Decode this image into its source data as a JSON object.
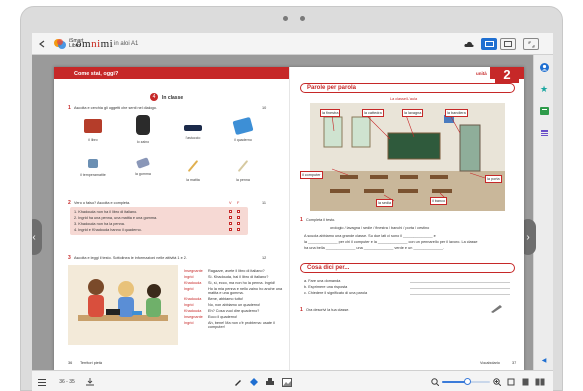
{
  "app": {
    "logo_text": "iSmart Libro",
    "brand": {
      "prefix": "om",
      "highlight": "ni",
      "suffix": "mi"
    },
    "breadcrumb": "in aloi A1"
  },
  "colors": {
    "accent": "#c62828",
    "toolbar_active": "#1f6fd1",
    "sidebar_icons": [
      "#1f6fd1",
      "#1aa6a0",
      "#2e9b4a",
      "#6a4fc9"
    ]
  },
  "left_page": {
    "tag": "Come stai, oggi?",
    "badge": "4",
    "section_title": "In classe",
    "ex1": {
      "num": "1",
      "instruction": "Ascolta e cerchia gli oggetti che senti nel dialogo.",
      "track": "10"
    },
    "items_row1": [
      "il libro",
      "lo zaino",
      "l'astuccio",
      "il quaderno"
    ],
    "items_row2": [
      "il temperamatite",
      "la gomma",
      "la matita",
      "la penna"
    ],
    "ex2": {
      "num": "2",
      "instruction": "Vero o falso? Ascolta e completa.",
      "cols": [
        "V",
        "F"
      ],
      "track": "11",
      "lines": [
        "1. Khadouda non ha il libro di italiano.",
        "2. Ingrid ha una penna, una matita e una gomma.",
        "3. Khadouda non ha la penna.",
        "4. Ingrid e Khadouda hanno il quaderno."
      ]
    },
    "ex3": {
      "num": "3",
      "instruction": "Ascolta e leggi il testo. Sottolinea le informazioni nelle attività 1 e 2.",
      "track": "12",
      "dialogue": [
        {
          "speaker": "Insegnante",
          "text": "Ragazze, avete il libro di italiano?"
        },
        {
          "speaker": "Ingrid",
          "text": "Sì. Khadouda, hai il libro di italiano?"
        },
        {
          "speaker": "Khadouda",
          "text": "Sì, sì, ecco, ma non ho la penna. Ingrid!"
        },
        {
          "speaker": "Ingrid",
          "text": "Ho la mia penna e nello zaino ho anche una matita e una gomma."
        },
        {
          "speaker": "Khadouda",
          "text": "Bene, abbiamo tutto!"
        },
        {
          "speaker": "Ingrid",
          "text": "No, non abbiamo un quaderno!"
        },
        {
          "speaker": "Khadouda",
          "text": "Eh? Cosa vuol dire quaderno?"
        },
        {
          "speaker": "Insegnante",
          "text": "Ecco il quaderno!"
        },
        {
          "speaker": "Ingrid",
          "text": "Ah, bene! Ma non c'è problema: usate il computer!"
        }
      ]
    },
    "footer": {
      "page": "36",
      "label": "Territori pietà"
    }
  },
  "right_page": {
    "unit_label": "unità",
    "unit_number": "2",
    "section1": "Parole per parola",
    "image_caption": "La classe/L'aula",
    "labels": [
      "la finestra",
      "la cattedra",
      "la lavagna",
      "la bandiera",
      "il banco",
      "la sedia",
      "la porta",
      "il computer",
      "il quaderno"
    ],
    "ex1": {
      "num": "1",
      "instruction": "Completa il testo.",
      "word_bank": "orologio / lavagna / sedie / finestra / banchi / porta / cestino",
      "lines": [
        "A scuola abbiamo una grande classe. Su due lati ci sono il ______________ e",
        "la ______________ per chi il computer e la ______________ con un pennarello per il lavoro. La classe",
        "ha una bella ______________ una ______________ verde e un ______________."
      ]
    },
    "section2": "Cosa dici per...",
    "ex2_lines": [
      "a. Fare una domanda",
      "b. Esprimere una risposta",
      "c. Chiedere il significato di una parola"
    ],
    "ex3": {
      "num": "1",
      "instruction": "Ora descrivi la tua classe."
    },
    "footer": {
      "label": "Vocabolario",
      "page": "37"
    }
  },
  "bottombar": {
    "page_indicator": "36 - 35",
    "icons": [
      "list-icon",
      "download-icon",
      "pen-icon",
      "eraser-icon",
      "print-icon",
      "gallery-icon",
      "zoom-out-icon",
      "zoom-in-icon",
      "fit-icon",
      "single-page-icon",
      "double-page-icon"
    ],
    "zoom_level": 0.52
  }
}
